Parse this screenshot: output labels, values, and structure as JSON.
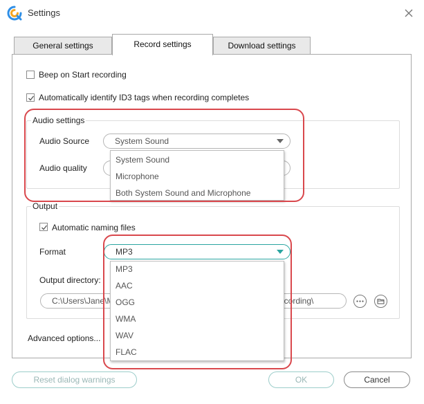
{
  "window": {
    "title": "Settings",
    "app_icon": "app-logo-icon",
    "close_icon": "close-icon"
  },
  "tabs": [
    {
      "label": "General settings",
      "active": false
    },
    {
      "label": "Record settings",
      "active": true
    },
    {
      "label": "Download settings",
      "active": false
    }
  ],
  "record": {
    "beep_on_start": {
      "label": "Beep on Start recording",
      "checked": false
    },
    "auto_id3": {
      "label": "Automatically identify ID3 tags when recording completes",
      "checked": true
    }
  },
  "audio_settings": {
    "title": "Audio settings",
    "source_label": "Audio Source",
    "source_value": "System Sound",
    "quality_label": "Audio quality",
    "source_options": [
      "System Sound",
      "Microphone",
      "Both System Sound and Microphone"
    ]
  },
  "output": {
    "title": "Output",
    "auto_naming": {
      "label": "Automatic naming files",
      "checked": true
    },
    "format_label": "Format",
    "format_value": "MP3",
    "format_options": [
      "MP3",
      "AAC",
      "OGG",
      "WMA",
      "WAV",
      "FLAC"
    ],
    "directory_label": "Output directory:",
    "directory_left": "C:\\Users\\Jane\\M",
    "directory_right": "recording\\",
    "more_icon": "more-horizontal-icon",
    "folder_icon": "folder-icon"
  },
  "advanced_label": "Advanced options...",
  "footer": {
    "reset_label": "Reset dialog warnings",
    "ok_label": "OK",
    "cancel_label": "Cancel"
  },
  "colors": {
    "highlight": "#d9474c",
    "accent": "#2aa5a0",
    "logo_blue": "#2f8fe6",
    "logo_orange": "#f5a623"
  }
}
